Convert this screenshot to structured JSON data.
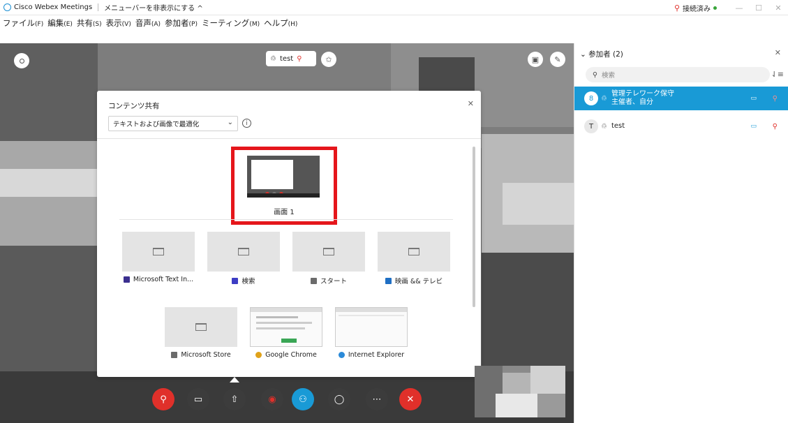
{
  "titlebar": {
    "app_title": "Cisco Webex Meetings",
    "hide_menu": "メニューバーを非表示にする ^",
    "connection_status": "接続済み",
    "window_buttons": [
      "—",
      "☐",
      "✕"
    ]
  },
  "menubar": [
    {
      "label": "ファイル",
      "accel": "(F)"
    },
    {
      "label": "編集",
      "accel": "(E)"
    },
    {
      "label": "共有",
      "accel": "(S)"
    },
    {
      "label": "表示",
      "accel": "(V)"
    },
    {
      "label": "音声",
      "accel": "(A)"
    },
    {
      "label": "参加者",
      "accel": "(P)"
    },
    {
      "label": "ミーティング",
      "accel": "(M)"
    },
    {
      "label": "ヘルプ",
      "accel": "(H)"
    }
  ],
  "active_speaker": {
    "name": "test"
  },
  "share_dialog": {
    "title": "コンテンツ共有",
    "optimize_value": "テキストおよび画像で最適化",
    "screen_label": "画面 1",
    "apps": [
      {
        "label": "Microsoft Text In...",
        "color": "#3b2f8f"
      },
      {
        "label": "検索",
        "color": "#3d3dc4"
      },
      {
        "label": "スタート",
        "color": "#6b6b6b"
      },
      {
        "label": "映画 && テレビ",
        "color": "#1f6fc4"
      },
      {
        "label": "Microsoft Store",
        "color": "#6b6b6b"
      },
      {
        "label": "Google Chrome",
        "color": "#e0a21a"
      },
      {
        "label": "Internet Explorer",
        "color": "#2b8ad8"
      }
    ]
  },
  "participants_panel": {
    "header": "参加者 (2)",
    "search_placeholder": "検索",
    "participants": [
      {
        "name": "管理テレワーク保守",
        "role": "主催者、自分",
        "avatar": "8",
        "active": true
      },
      {
        "name": "test",
        "role": "",
        "avatar": "T",
        "active": false
      }
    ]
  },
  "colors": {
    "accent_blue": "#199ad6",
    "mute_red": "#e0302a",
    "highlight_red": "#e5161b",
    "connected_green": "#38a53a"
  },
  "icons": [
    "mic-muted-icon",
    "video-off-icon",
    "share-icon",
    "record-icon",
    "participants-icon",
    "chat-icon",
    "more-icon",
    "end-meeting-icon"
  ]
}
